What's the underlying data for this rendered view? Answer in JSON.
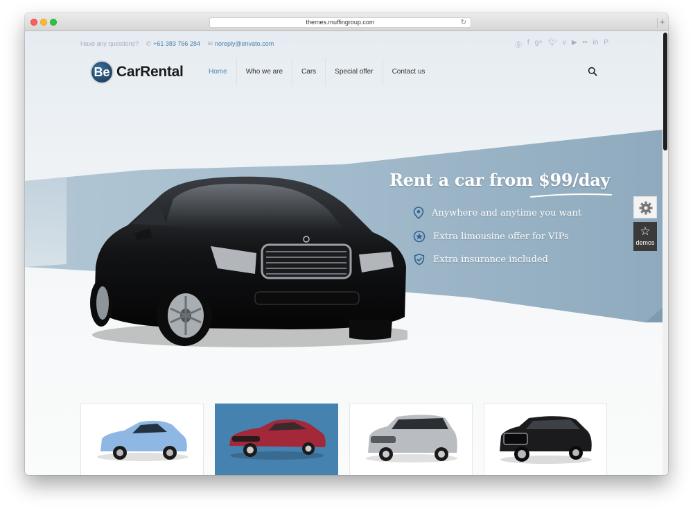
{
  "browser": {
    "url": "themes.muffingroup.com"
  },
  "topbar": {
    "question": "Have any questions?",
    "phone": "+61 383 766 284",
    "email": "noreply@envato.com",
    "socials": [
      "skype-icon",
      "facebook-icon",
      "google-plus-icon",
      "twitter-icon",
      "vimeo-icon",
      "youtube-icon",
      "flickr-icon",
      "linkedin-icon",
      "pinterest-icon"
    ]
  },
  "logo": {
    "badge": "Be",
    "name": "CarRental"
  },
  "nav": {
    "items": [
      "Home",
      "Who we are",
      "Cars",
      "Special offer",
      "Contact us"
    ],
    "active": "Home"
  },
  "hero": {
    "headline": "Rent a car from $99/day",
    "features": [
      {
        "icon": "location-pin-icon",
        "text": "Anywhere and anytime you want"
      },
      {
        "icon": "star-badge-icon",
        "text": "Extra limousine offer for VIPs"
      },
      {
        "icon": "shield-icon",
        "text": "Extra insurance included"
      }
    ]
  },
  "widgets": {
    "demos_label": "demos"
  },
  "cards": [
    {
      "car_color": "#8fb7e3"
    },
    {
      "car_color": "#a3283a",
      "active": true
    },
    {
      "car_color": "#b9bcc0"
    },
    {
      "car_color": "#1b1b1d"
    }
  ],
  "colors": {
    "accent": "#4a86b5",
    "band": "#9fb8c9",
    "active_card": "#4682b0"
  }
}
